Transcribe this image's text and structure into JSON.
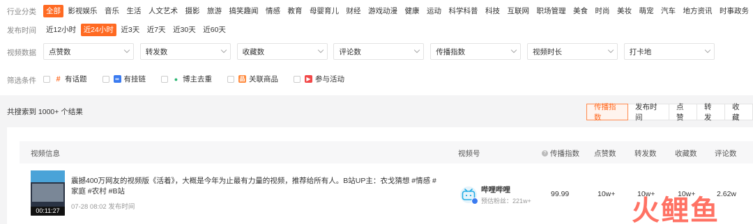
{
  "filters": {
    "industry_label": "行业分类",
    "industry": [
      "全部",
      "影视娱乐",
      "音乐",
      "生活",
      "人文艺术",
      "摄影",
      "旅游",
      "搞笑趣闻",
      "情感",
      "教育",
      "母婴育儿",
      "财经",
      "游戏动漫",
      "健康",
      "运动",
      "科学科普",
      "科技",
      "互联网",
      "职场管理",
      "美食",
      "时尚",
      "美妆",
      "萌宠",
      "汽车",
      "地方资讯",
      "时事政务"
    ],
    "time_label": "发布时间",
    "time": [
      "近12小时",
      "近24小时",
      "近3天",
      "近7天",
      "近30天",
      "近60天"
    ],
    "data_label": "视频数据",
    "data_selects": [
      "点赞数",
      "转发数",
      "收藏数",
      "评论数",
      "传播指数",
      "视频时长",
      "打卡地"
    ],
    "cond_label": "筛选条件",
    "conditions": [
      {
        "label": "有话题",
        "icon": "hashtag-icon",
        "color": "#ff6a22"
      },
      {
        "label": "有挂链",
        "icon": "link-icon",
        "color": "#3b7bf0"
      },
      {
        "label": "博主去重",
        "icon": "user-icon",
        "color": "#2bb673"
      },
      {
        "label": "关联商品",
        "icon": "product-icon",
        "color": "#ff8a3d"
      },
      {
        "label": "参与活动",
        "icon": "flag-icon",
        "color": "#f24848"
      }
    ]
  },
  "results": {
    "summary": "共搜索到 1000+ 个结果",
    "sorts": [
      "传播指数",
      "发布时间",
      "点赞",
      "转发",
      "收藏"
    ]
  },
  "table": {
    "headers": {
      "video": "视频信息",
      "channel": "视频号",
      "spread": "传播指数",
      "likes": "点赞数",
      "shares": "转发数",
      "favorites": "收藏数",
      "comments": "评论数"
    },
    "rows": [
      {
        "duration": "00:11:27",
        "title": "震撼400万网友的视频版《活着》，大概是今年为止最有力量的视频，推荐给所有人。B站UP主：衣戈猜想 #情感 #家庭 #农村 #B站",
        "date": "07-28 08:02 发布时间",
        "channel_name": "哔哩哔哩",
        "channel_fans": "预估粉丝：221w+",
        "spread": "99.99",
        "likes": "10w+",
        "shares": "10w+",
        "favorites": "10w+",
        "comments": "2.62w"
      }
    ]
  },
  "watermark": "火鲤鱼"
}
